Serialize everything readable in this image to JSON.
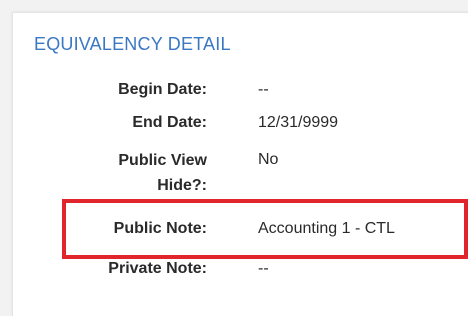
{
  "section": {
    "title": "EQUIVALENCY DETAIL"
  },
  "fields": [
    {
      "label": "Begin Date:",
      "value": "--"
    },
    {
      "label": "End Date:",
      "value": "12/31/9999"
    },
    {
      "label": "Public View Hide?:",
      "value": "No"
    },
    {
      "label": "Public Note:",
      "value": "Accounting 1 - CTL"
    },
    {
      "label": "Private Note:",
      "value": "--"
    }
  ],
  "colors": {
    "title": "#3a78c3",
    "highlight": "#e0252c",
    "text": "#2a2a2a"
  }
}
